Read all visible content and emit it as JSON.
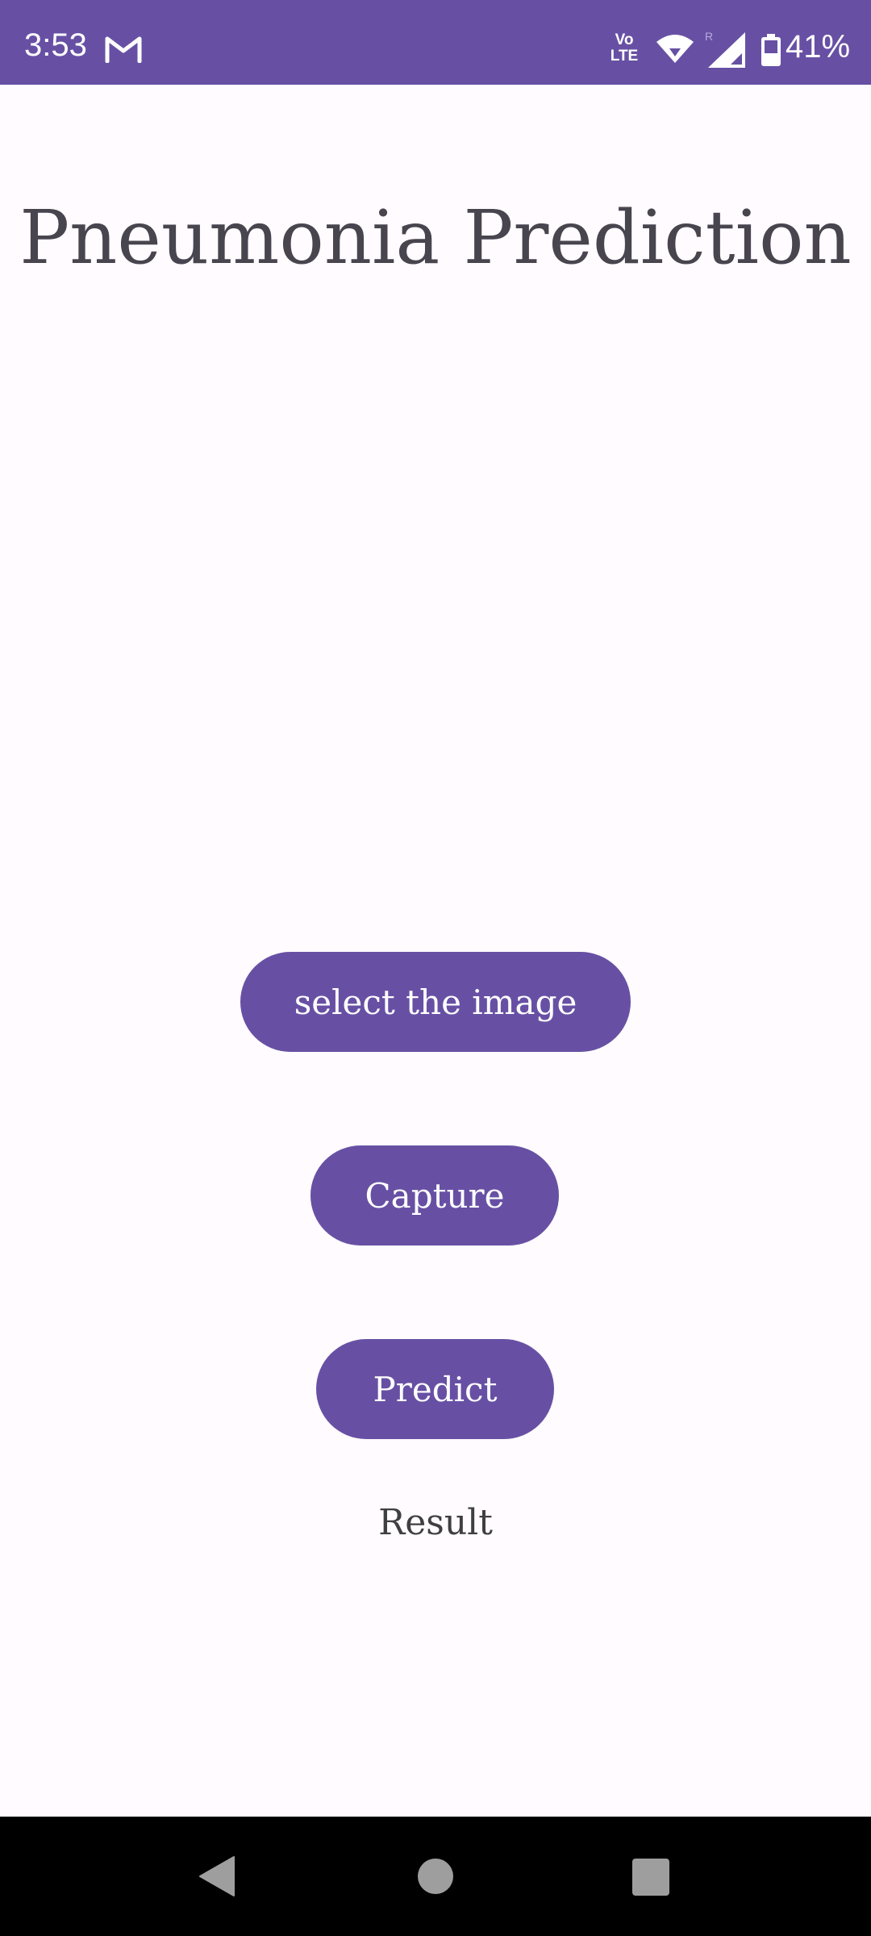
{
  "status_bar": {
    "time": "3:53",
    "mail_icon": "gmail-icon",
    "volte_line1": "Vo",
    "volte_line2": "LTE",
    "wifi_icon": "wifi-icon",
    "signal_icon": "cell-signal-icon",
    "roaming_label": "R",
    "battery_icon": "battery-icon",
    "battery_percent": "41%"
  },
  "app": {
    "title": "Pneumonia Prediction",
    "select_label": "select the image",
    "capture_label": "Capture",
    "predict_label": "Predict",
    "result_text": "Result"
  },
  "colors": {
    "primary": "#6750a4",
    "background": "#fffbfe",
    "title_text": "#49454f",
    "nav_bar": "#000000"
  },
  "nav_bar": {
    "back_icon": "back-triangle-icon",
    "home_icon": "home-circle-icon",
    "recents_icon": "recents-square-icon"
  }
}
